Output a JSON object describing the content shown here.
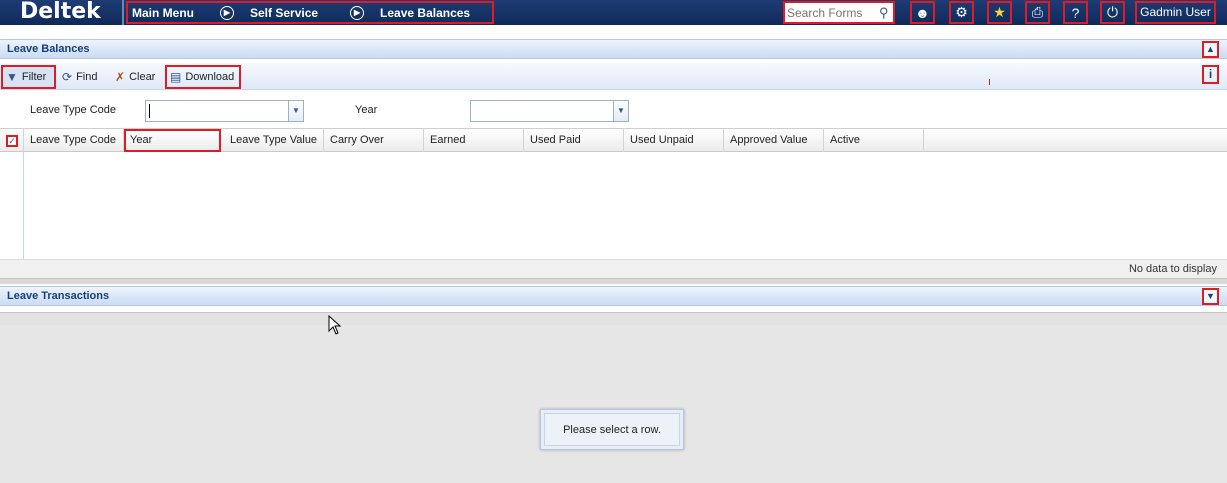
{
  "app": {
    "logo": "Deltek"
  },
  "breadcrumb": {
    "items": [
      "Main Menu",
      "Self Service",
      "Leave Balances"
    ]
  },
  "search": {
    "placeholder": "Search Forms"
  },
  "toolbar_icons": [
    "person-icon",
    "gear-icon",
    "star-icon",
    "print-icon",
    "help-icon",
    "power-icon"
  ],
  "user": {
    "name": "Gadmin User"
  },
  "leave_balances": {
    "title": "Leave Balances",
    "toolbar": {
      "filter": "Filter",
      "find": "Find",
      "clear": "Clear",
      "download": "Download"
    },
    "filters": {
      "leave_type_code_label": "Leave Type Code",
      "year_label": "Year",
      "leave_type_code_value": "",
      "year_value": ""
    },
    "columns": [
      "Leave Type Code",
      "Year",
      "Leave Type Value",
      "Carry Over",
      "Earned",
      "Used Paid",
      "Used Unpaid",
      "Approved Value",
      "Active"
    ],
    "rows": [],
    "footer": "No data to display"
  },
  "leave_transactions": {
    "title": "Leave Transactions",
    "message": "Please select a row."
  },
  "colors": {
    "header_bg": "#0e2a5c",
    "highlight": "#e01b24",
    "panel_title": "#173f7a"
  }
}
